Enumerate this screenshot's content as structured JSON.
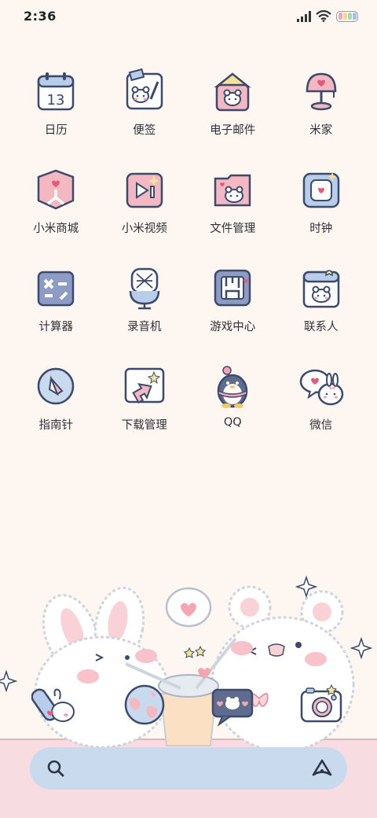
{
  "status_bar": {
    "time": "2:36",
    "icons": [
      "signal-icon",
      "wifi-icon",
      "battery-icon"
    ],
    "battery_colors": [
      "#f3a7b4",
      "#f5d98f",
      "#a9d8b8",
      "#9fc3ea"
    ]
  },
  "apps": [
    {
      "label": "日历",
      "icon": "calendar-icon",
      "calendar_day": "13"
    },
    {
      "label": "便签",
      "icon": "notes-icon"
    },
    {
      "label": "电子邮件",
      "icon": "email-icon"
    },
    {
      "label": "米家",
      "icon": "mijia-lamp-icon"
    },
    {
      "label": "小米商城",
      "icon": "mi-store-icon"
    },
    {
      "label": "小米视频",
      "icon": "mi-video-icon"
    },
    {
      "label": "文件管理",
      "icon": "file-manager-icon"
    },
    {
      "label": "时钟",
      "icon": "clock-icon"
    },
    {
      "label": "计算器",
      "icon": "calculator-icon"
    },
    {
      "label": "录音机",
      "icon": "recorder-icon"
    },
    {
      "label": "游戏中心",
      "icon": "game-center-icon"
    },
    {
      "label": "联系人",
      "icon": "contacts-icon"
    },
    {
      "label": "指南针",
      "icon": "compass-icon"
    },
    {
      "label": "下载管理",
      "icon": "download-manager-icon"
    },
    {
      "label": "QQ",
      "icon": "qq-penguin-icon"
    },
    {
      "label": "微信",
      "icon": "wechat-bunny-icon"
    }
  ],
  "dock": [
    {
      "icon": "phone-bunny-icon"
    },
    {
      "icon": "browser-globe-icon"
    },
    {
      "icon": "messages-icon"
    },
    {
      "icon": "camera-icon"
    }
  ],
  "search_bar": {
    "left_icon": "search-icon",
    "right_icon": "assistant-icon"
  },
  "colors": {
    "background": "#fdf6f1",
    "pink": "#f2a6b1",
    "blue": "#c9d9ee",
    "outline": "#3d4a6b"
  }
}
